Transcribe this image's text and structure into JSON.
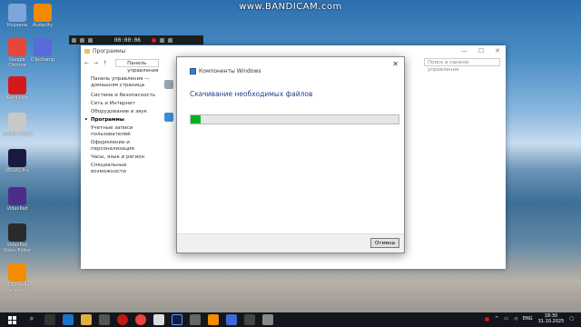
{
  "watermark": "www.BANDICAM.com",
  "desktop": {
    "icons": [
      {
        "label": "Корзина",
        "color": "#7aa7d8",
        "icon": "recycle-bin-icon"
      },
      {
        "label": "Audacity",
        "color": "#f08a00",
        "icon": "audacity-icon"
      },
      {
        "label": "Google Chrome",
        "color": "#e8453c",
        "icon": "chrome-icon"
      },
      {
        "label": "Clipchamp",
        "color": "#5a6ad8",
        "icon": "clipchamp-icon"
      },
      {
        "label": "Bandicam",
        "color": "#d11a1a",
        "icon": "bandicam-icon"
      },
      {
        "label": "Roblox Player",
        "color": "#c8c8c8",
        "icon": "roblox-icon"
      },
      {
        "label": "VEGAS Pro",
        "color": "#1a1a40",
        "icon": "vegas-icon"
      },
      {
        "label": "VideoPad",
        "color": "#4b2d8a",
        "icon": "videopad-icon"
      },
      {
        "label": "VideoPad Video Editor",
        "color": "#2a2a2a",
        "icon": "video-editor-icon"
      },
      {
        "label": "VLC media player",
        "color": "#f28c00",
        "icon": "vlc-icon"
      }
    ]
  },
  "bandicam": {
    "time": "00:00:06"
  },
  "control_panel": {
    "title": "Программы",
    "breadcrumb": "Панель управления",
    "search_placeholder": "Поиск в панели управления",
    "sidebar": [
      "Панель управления — домашняя страница",
      "Система и безопасность",
      "Сеть и Интернет",
      "Оборудование и звук",
      "Программы",
      "Учетные записи пользователей",
      "Оформление и персонализация",
      "Часы, язык и регион",
      "Специальные возможности"
    ]
  },
  "dialog": {
    "title": "Компоненты Windows",
    "heading": "Скачивание необходимых файлов",
    "progress": 0.05,
    "cancel": "Отмена",
    "close": "✕"
  },
  "taskbar": {
    "language": "ENG",
    "time": "18:30",
    "date": "31.10.2025"
  }
}
